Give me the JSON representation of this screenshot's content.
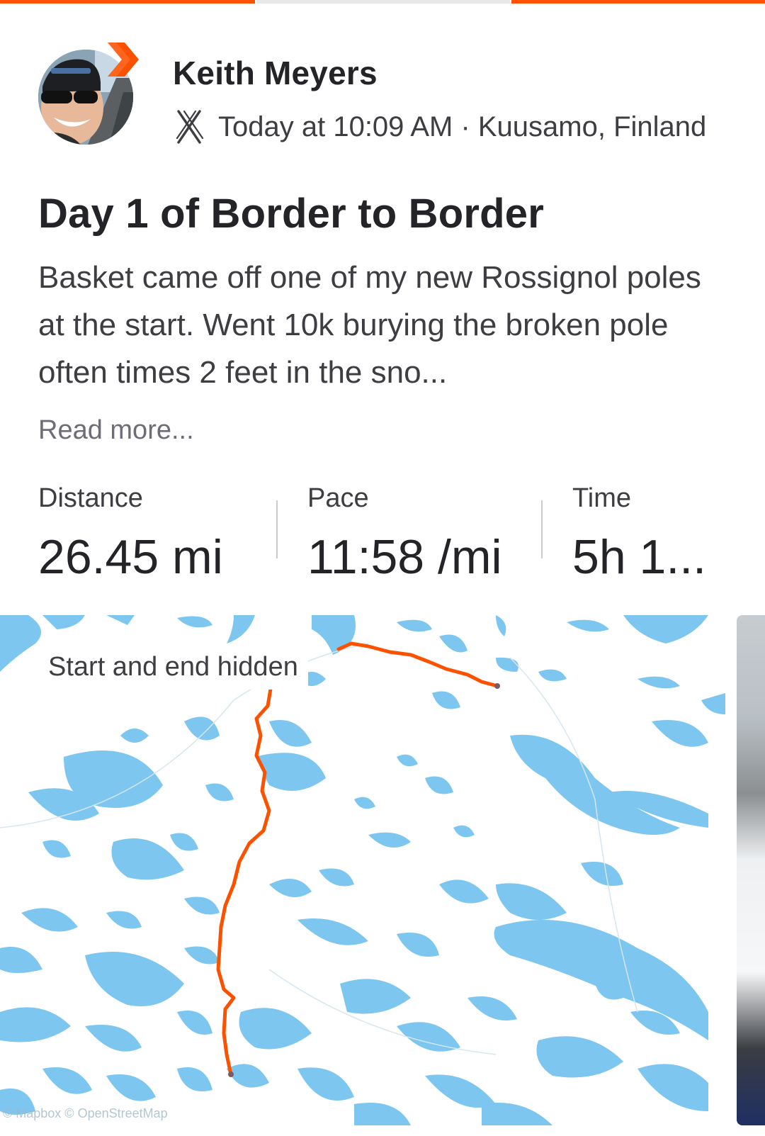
{
  "colors": {
    "accent": "#fc5200",
    "water": "#7cc6ef",
    "route": "#fc5200"
  },
  "header": {
    "avatar_icon": "profile-photo",
    "badge_icon": "subscriber-chevron-icon",
    "athlete_name": "Keith Meyers",
    "sport_icon": "nordic-ski-icon",
    "meta": "Today at 10:09 AM · Kuusamo, Finland"
  },
  "activity": {
    "title": "Day 1 of Border to Border",
    "description": "Basket came off one of my new Rossignol poles at the start. Went 10k burying the broken pole often times 2 feet in the sno...",
    "read_more": "Read more..."
  },
  "stats": [
    {
      "label": "Distance",
      "value": "26.45 mi"
    },
    {
      "label": "Pace",
      "value": "11:58 /mi"
    },
    {
      "label": "Time",
      "value": "5h 1..."
    }
  ],
  "map": {
    "badge": "Start and end hidden",
    "attribution": "© Mapbox © OpenStreetMap"
  }
}
